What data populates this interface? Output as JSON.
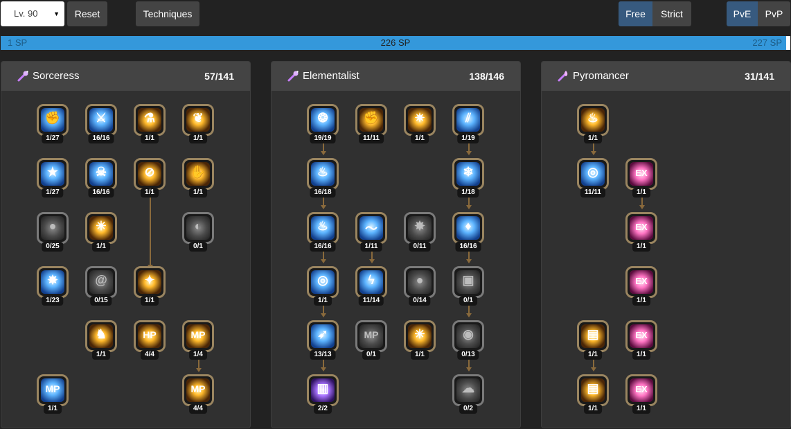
{
  "toolbar": {
    "level": "Lv. 90",
    "reset_label": "Reset",
    "techniques_label": "Techniques",
    "free_label": "Free",
    "strict_label": "Strict",
    "pve_label": "PvE",
    "pvp_label": "PvP",
    "mode_selected": "Free",
    "pvx_selected": "PvE",
    "accent_color": "#375a7f"
  },
  "sp_bar": {
    "min_label": "1 SP",
    "current_label": "226 SP",
    "max_label": "227 SP",
    "fill_fraction": 0.995,
    "color": "#3498db"
  },
  "panels": [
    {
      "name": "Sorceress",
      "points": "57/141",
      "icon": "wand-icon",
      "skills": [
        {
          "level": "1/27",
          "style": "blue",
          "icon": "fist-icon"
        },
        {
          "level": "16/16",
          "style": "blue",
          "icon": "blade-icon"
        },
        {
          "level": "1/1",
          "style": "gold",
          "icon": "cauldron-icon"
        },
        {
          "level": "1/1",
          "style": "gold",
          "icon": "wing-icon"
        },
        {
          "level": "1/27",
          "style": "blue",
          "icon": "star-icon"
        },
        {
          "level": "16/16",
          "style": "blue",
          "icon": "skull-icon"
        },
        {
          "level": "1/1",
          "style": "gold",
          "icon": "no-symbol-icon"
        },
        {
          "level": "1/1",
          "style": "gold",
          "icon": "hand-icon"
        },
        {
          "level": "0/25",
          "style": "gray",
          "icon": "orb-icon"
        },
        {
          "level": "1/1",
          "style": "gold",
          "icon": "figure-icon"
        },
        {
          "level": "0/1",
          "style": "gray",
          "icon": "shield-icon"
        },
        {
          "level": "1/23",
          "style": "blue",
          "icon": "burst-icon"
        },
        {
          "level": "0/15",
          "style": "gray",
          "icon": "spiral-icon"
        },
        {
          "level": "1/1",
          "style": "gold",
          "icon": "vitruvian-icon"
        },
        {
          "level": "1/1",
          "style": "gold",
          "icon": "dancer-icon"
        },
        {
          "level": "4/4",
          "style": "gold",
          "icon": "hp-icon"
        },
        {
          "level": "1/4",
          "style": "gold",
          "icon": "mp-icon"
        },
        {
          "level": "1/1",
          "style": "blue",
          "icon": "mp-down-icon"
        },
        {
          "level": "4/4",
          "style": "gold",
          "icon": "mp-up-icon"
        }
      ]
    },
    {
      "name": "Elementalist",
      "points": "138/146",
      "icon": "wand-icon",
      "skills": [
        {
          "level": "19/19",
          "style": "blue",
          "icon": "swirl-icon"
        },
        {
          "level": "11/11",
          "style": "gold",
          "icon": "fist-icon"
        },
        {
          "level": "1/1",
          "style": "gold",
          "icon": "spark-icon"
        },
        {
          "level": "1/19",
          "style": "blue",
          "icon": "claw-icon"
        },
        {
          "level": "16/18",
          "style": "blue",
          "icon": "flame-icon"
        },
        {
          "level": "1/18",
          "style": "blue",
          "icon": "ice-icon"
        },
        {
          "level": "16/16",
          "style": "blue",
          "icon": "fire-icon"
        },
        {
          "level": "1/11",
          "style": "blue",
          "icon": "wave-icon"
        },
        {
          "level": "0/11",
          "style": "gray",
          "icon": "burst-icon"
        },
        {
          "level": "16/16",
          "style": "blue",
          "icon": "crystal-icon"
        },
        {
          "level": "1/1",
          "style": "blue",
          "icon": "ring-icon"
        },
        {
          "level": "11/14",
          "style": "blue",
          "icon": "bolt-icon"
        },
        {
          "level": "0/14",
          "style": "gray",
          "icon": "orb-icon"
        },
        {
          "level": "0/1",
          "style": "gray",
          "icon": "cube-icon"
        },
        {
          "level": "13/13",
          "style": "blue",
          "icon": "runner-icon"
        },
        {
          "level": "0/1",
          "style": "gray",
          "icon": "mp-icon"
        },
        {
          "level": "1/1",
          "style": "gold",
          "icon": "sun-icon"
        },
        {
          "level": "0/13",
          "style": "gray",
          "icon": "vortex-icon"
        },
        {
          "level": "2/2",
          "style": "purple",
          "icon": "pillar-icon"
        },
        {
          "level": "0/2",
          "style": "gray",
          "icon": "storm-icon"
        }
      ]
    },
    {
      "name": "Pyromancer",
      "points": "31/141",
      "icon": "flame-wand-icon",
      "skills": [
        {
          "level": "1/1",
          "style": "gold",
          "icon": "flame-icon"
        },
        {
          "level": "11/11",
          "style": "blue",
          "icon": "ring-icon"
        },
        {
          "level": "1/1",
          "style": "pink",
          "icon": "ex-icon"
        },
        {
          "level": "1/1",
          "style": "pink",
          "icon": "ex-icon"
        },
        {
          "level": "1/1",
          "style": "pink",
          "icon": "ex-icon"
        },
        {
          "level": "1/1",
          "style": "gold",
          "icon": "scroll-icon"
        },
        {
          "level": "1/1",
          "style": "pink",
          "icon": "ex-icon"
        },
        {
          "level": "1/1",
          "style": "gold",
          "icon": "scroll-icon"
        },
        {
          "level": "1/1",
          "style": "pink",
          "icon": "ex-icon"
        }
      ]
    }
  ]
}
